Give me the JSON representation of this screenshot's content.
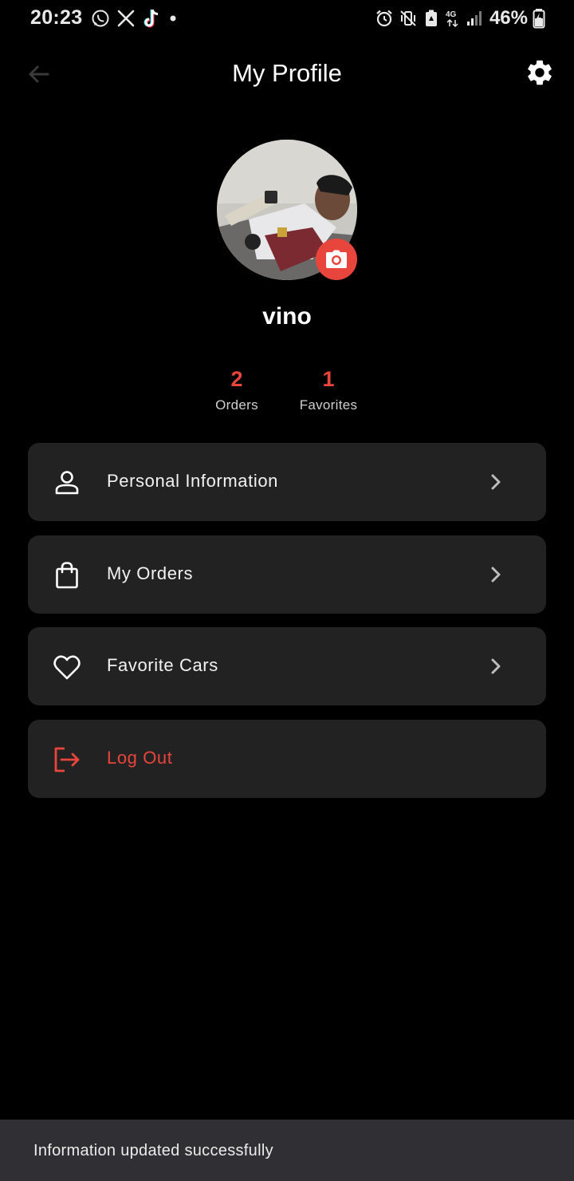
{
  "status_bar": {
    "time": "20:23",
    "battery": "46%",
    "left_icons": [
      "whatsapp-icon",
      "x-icon",
      "tiktok-icon",
      "dot-icon"
    ],
    "right_icons": [
      "alarm-icon",
      "vibrate-icon",
      "battery-saver-icon",
      "network-4g-icon",
      "signal-icon",
      "battery-icon"
    ]
  },
  "app_bar": {
    "title": "My Profile"
  },
  "profile": {
    "name": "vino"
  },
  "stats": {
    "orders_value": "2",
    "orders_label": "Orders",
    "favorites_value": "1",
    "favorites_label": "Favorites"
  },
  "menu": {
    "items": [
      {
        "label": "Personal Information",
        "icon": "person-icon"
      },
      {
        "label": "My Orders",
        "icon": "shopping-bag-icon"
      },
      {
        "label": "Favorite Cars",
        "icon": "heart-icon"
      },
      {
        "label": "Log Out",
        "icon": "logout-icon"
      }
    ]
  },
  "snackbar": {
    "message": "Information updated successfully"
  },
  "colors": {
    "background": "#000000",
    "card": "#222222",
    "accent": "#e8453c",
    "snackbar": "#302f33"
  }
}
